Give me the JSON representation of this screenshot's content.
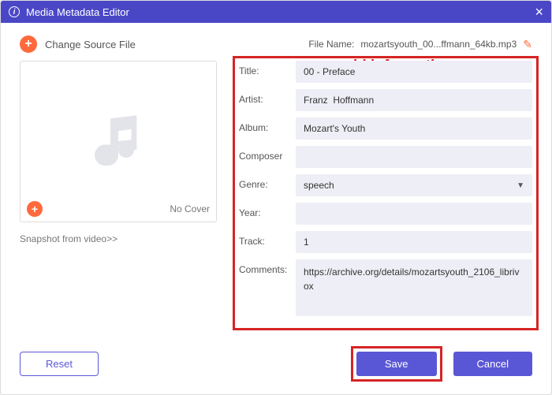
{
  "window": {
    "title": "Media Metadata Editor"
  },
  "top": {
    "change_source_label": "Change Source File",
    "filename_label": "File Name:",
    "filename_value": "mozartsyouth_00...ffmann_64kb.mp3"
  },
  "annotation": "add informations",
  "cover": {
    "no_cover_label": "No Cover",
    "snapshot_label": "Snapshot from video>>"
  },
  "form": {
    "title_label": "Title:",
    "title_value": "00 - Preface",
    "artist_label": "Artist:",
    "artist_value": "Franz  Hoffmann",
    "album_label": "Album:",
    "album_value": "Mozart's Youth",
    "composer_label": "Composer",
    "composer_value": "",
    "genre_label": "Genre:",
    "genre_value": "speech",
    "year_label": "Year:",
    "year_value": "",
    "track_label": "Track:",
    "track_value": "1",
    "comments_label": "Comments:",
    "comments_value": "https://archive.org/details/mozartsyouth_2106_librivox"
  },
  "footer": {
    "reset_label": "Reset",
    "save_label": "Save",
    "cancel_label": "Cancel"
  }
}
